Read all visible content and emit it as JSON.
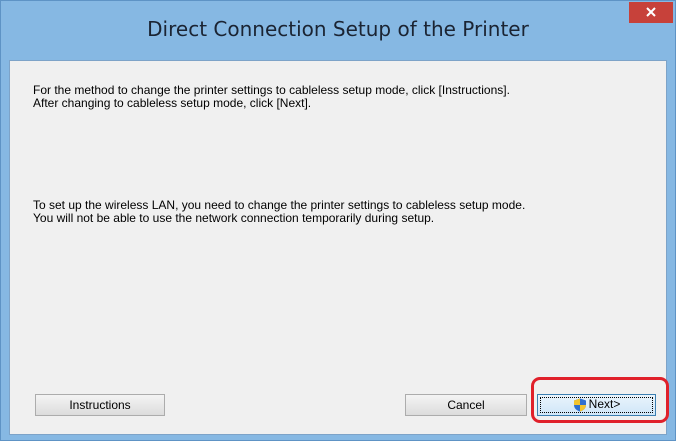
{
  "window": {
    "title": "Direct Connection Setup of the Printer",
    "close_icon": "close-icon"
  },
  "content": {
    "paragraph1_line1": "For the method to change the printer settings to cableless setup mode, click [Instructions].",
    "paragraph1_line2": "After changing to cableless setup mode, click [Next].",
    "paragraph2_line1": "To set up the wireless LAN, you need to change the printer settings to cableless setup mode.",
    "paragraph2_line2": "You will not be able to use the network connection temporarily during setup."
  },
  "buttons": {
    "instructions_label": "Instructions",
    "cancel_label": "Cancel",
    "next_label": "Next>",
    "next_icon": "shield-icon"
  },
  "colors": {
    "title_bar": "#86b8e3",
    "close_button": "#c7413a",
    "client_background": "#f0f0f0",
    "highlight": "#e0202a"
  }
}
